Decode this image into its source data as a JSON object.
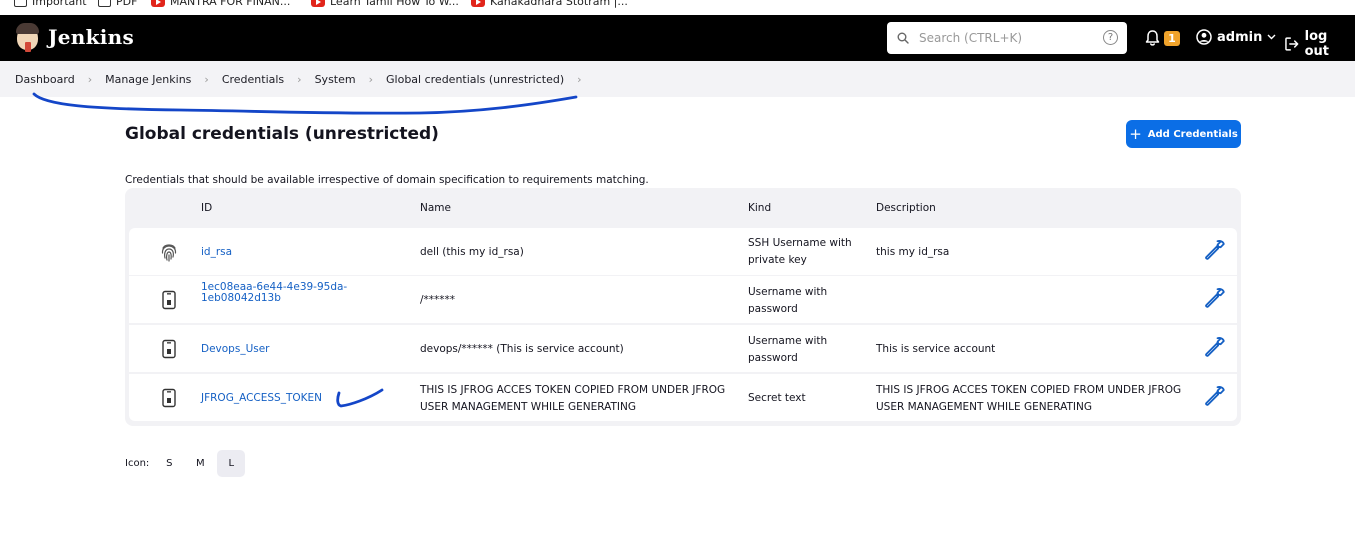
{
  "bookmarks": [
    {
      "label": "Important",
      "icon": "folder-icon"
    },
    {
      "label": "PDF",
      "icon": "folder-icon"
    },
    {
      "label": "MANTRA FOR FINAN...",
      "icon": "youtube-icon"
    },
    {
      "label": "Learn Tamil How To W...",
      "icon": "youtube-icon"
    },
    {
      "label": "Kanakadhara Stotram |...",
      "icon": "youtube-icon"
    }
  ],
  "header": {
    "app_name": "Jenkins",
    "search_placeholder": "Search (CTRL+K)",
    "help_label": "?",
    "notification_count": "1",
    "user_name": "admin",
    "logout_label": "log out"
  },
  "breadcrumb": [
    "Dashboard",
    "Manage Jenkins",
    "Credentials",
    "System",
    "Global credentials (unrestricted)"
  ],
  "main": {
    "title": "Global credentials (unrestricted)",
    "add_button_label": "Add Credentials",
    "description": "Credentials that should be available irrespective of domain specification to requirements matching."
  },
  "table": {
    "columns": [
      "ID",
      "Name",
      "Kind",
      "Description"
    ],
    "rows": [
      {
        "icon": "fingerprint-icon",
        "id_lines": [
          "id_rsa"
        ],
        "name_lines": [
          "dell (this my id_rsa)"
        ],
        "kind_lines": [
          "SSH Username with",
          "private key"
        ],
        "description_lines": [
          "this my id_rsa"
        ]
      },
      {
        "icon": "phone-badge-icon",
        "id_lines": [
          "1ec08eaa-6e44-4e39-95da-",
          "1eb08042d13b"
        ],
        "name_lines": [
          "/******"
        ],
        "kind_lines": [
          "Username with",
          "password"
        ],
        "description_lines": []
      },
      {
        "icon": "phone-badge-icon",
        "id_lines": [
          "Devops_User"
        ],
        "name_lines": [
          "devops/****** (This is service account)"
        ],
        "kind_lines": [
          "Username with",
          "password"
        ],
        "description_lines": [
          "This is service account"
        ]
      },
      {
        "icon": "phone-badge-icon",
        "id_lines": [
          "JFROG_ACCESS_TOKEN"
        ],
        "name_lines": [
          "THIS IS JFROG ACCES TOKEN COPIED FROM UNDER JFROG",
          "USER MANAGEMENT WHILE GENERATING"
        ],
        "kind_lines": [
          "Secret text"
        ],
        "description_lines": [
          "THIS IS JFROG ACCES TOKEN COPIED FROM UNDER JFROG",
          "USER MANAGEMENT WHILE GENERATING"
        ]
      }
    ]
  },
  "icon_size": {
    "label": "Icon:",
    "options": [
      "S",
      "M",
      "L"
    ],
    "selected": "L"
  },
  "colors": {
    "header_bg": "#000000",
    "accent_blue": "#0b6ee6",
    "link_blue": "#1560c4",
    "notification_badge": "#f0a32b",
    "annotation_ink": "#1446c8"
  }
}
